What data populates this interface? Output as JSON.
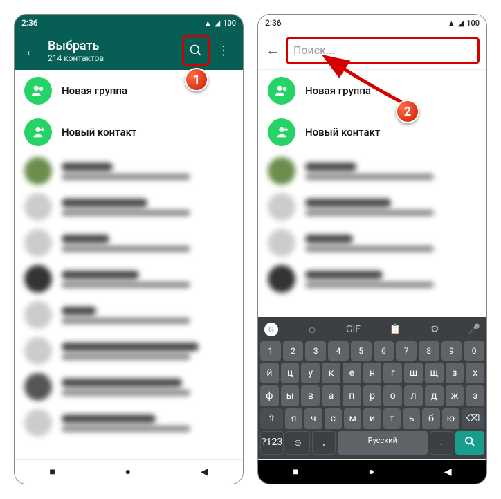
{
  "status": {
    "time": "2:36",
    "battery": "100"
  },
  "left": {
    "title": "Выбрать",
    "subtitle": "214 контактов",
    "new_group": "Новая группа",
    "new_contact": "Новый контакт"
  },
  "right": {
    "search_placeholder": "Поиск...",
    "new_group": "Новая группа",
    "new_contact": "Новый контакт"
  },
  "keyboard": {
    "gif": "GIF",
    "numbers": [
      "1",
      "2",
      "3",
      "4",
      "5",
      "6",
      "7",
      "8",
      "9",
      "0"
    ],
    "row1": [
      "й",
      "ц",
      "у",
      "к",
      "е",
      "н",
      "г",
      "ш",
      "щ",
      "з",
      "х"
    ],
    "row2": [
      "ф",
      "ы",
      "в",
      "а",
      "п",
      "р",
      "о",
      "л",
      "д",
      "ж",
      "э"
    ],
    "row3_shift": "⇧",
    "row3": [
      "я",
      "ч",
      "с",
      "м",
      "и",
      "т",
      "ь",
      "б",
      "ю"
    ],
    "row3_del": "⌫",
    "sym": "?123",
    "lang": "Русский",
    "search": "🔍"
  },
  "badges": {
    "one": "1",
    "two": "2"
  }
}
